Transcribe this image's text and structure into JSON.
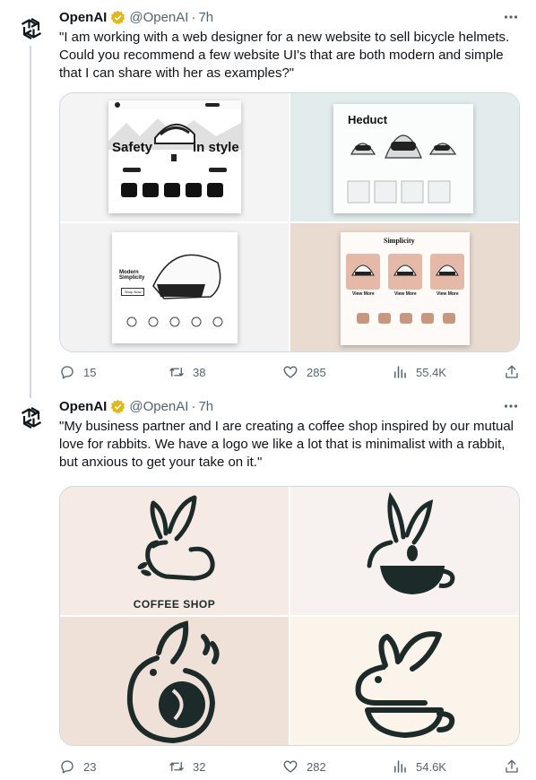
{
  "colors": {
    "text_primary": "#0f1419",
    "text_secondary": "#536471",
    "verified_gold": "#e2b719",
    "border": "#cfd9de"
  },
  "icons": {
    "more": "more-icon",
    "reply": "reply-icon",
    "retweet": "retweet-icon",
    "like": "like-icon",
    "views": "views-icon",
    "share": "share-icon",
    "verified": "verified-icon",
    "avatar": "openai-logo"
  },
  "tweets": [
    {
      "author": {
        "name": "OpenAI",
        "handle": "@OpenAI",
        "time": "7h"
      },
      "text": "\"I am working with a web designer for a new website to sell bicycle helmets. Could you recommend a few website UI's that are both modern and simple that I can share with her as examples?\"",
      "images": {
        "img1": {
          "headline_left": "Safety",
          "headline_right": "in style"
        },
        "img2": {
          "brand": "Heduct"
        },
        "img3": {
          "headline": "Modern Simplicity",
          "button": "Shop Now"
        },
        "img4": {
          "brand": "Simplicity",
          "button_1": "View More",
          "button_2": "View More",
          "button_3": "View More"
        }
      },
      "stats": {
        "replies": "15",
        "retweets": "38",
        "likes": "285",
        "views": "55.4K"
      }
    },
    {
      "author": {
        "name": "OpenAI",
        "handle": "@OpenAI",
        "time": "7h"
      },
      "text": "\"My business partner and I are creating a coffee shop inspired by our mutual love for rabbits. We have a logo we like a lot that is minimalist with a rabbit, but anxious to get your take on it.\"",
      "images": {
        "img1": {
          "caption": "COFFEE SHOP"
        }
      },
      "stats": {
        "replies": "23",
        "retweets": "32",
        "likes": "282",
        "views": "54.6K"
      }
    }
  ]
}
